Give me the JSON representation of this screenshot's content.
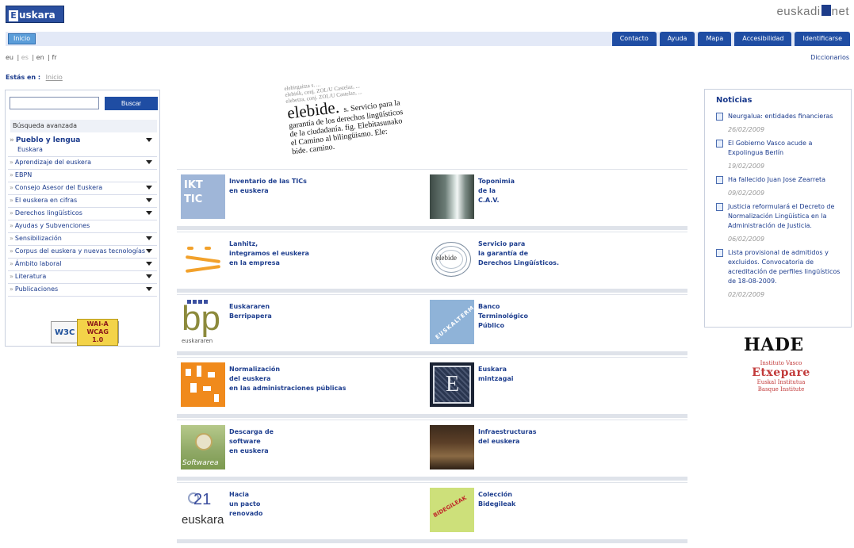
{
  "header": {
    "logo_text": "uskara",
    "logo_letter": "E",
    "portal_left": "euskadi",
    "portal_right": "net"
  },
  "nav": {
    "home": "Inicio",
    "links": [
      "Contacto",
      "Ayuda",
      "Mapa",
      "Accesibilidad",
      "Identificarse"
    ]
  },
  "langs": [
    "eu",
    "es",
    "en",
    "fr"
  ],
  "dictionary": "Diccionarios",
  "breadcrumb": {
    "label": "Estás en :",
    "home": "Inicio"
  },
  "sidebar": {
    "search_placeholder": "",
    "search_button": "Buscar",
    "advanced": "Búsqueda avanzada",
    "items": [
      {
        "label": "Pueblo y lengua",
        "sub": "Euskara",
        "expand": true,
        "big": true
      },
      {
        "label": "Aprendizaje del euskera",
        "expand": true
      },
      {
        "label": "EBPN",
        "expand": false
      },
      {
        "label": "Consejo Asesor del Euskera",
        "expand": true
      },
      {
        "label": "El euskera en cifras",
        "expand": true
      },
      {
        "label": "Derechos lingüísticos",
        "expand": true
      },
      {
        "label": "Ayudas y Subvenciones",
        "expand": false
      },
      {
        "label": "Sensibilización",
        "expand": true
      },
      {
        "label": "Corpus del euskera y nuevas tecnologías",
        "expand": true
      },
      {
        "label": "Ámbito laboral",
        "expand": true
      },
      {
        "label": "Literatura",
        "expand": true
      },
      {
        "label": "Publicaciones",
        "expand": true
      }
    ],
    "badge": {
      "w3c": "W3C",
      "wai1": "WAI-A",
      "wai2": "WCAG 1.0"
    }
  },
  "elebide": {
    "ghost1": "elebirgaitza  s.  ...",
    "ghost2": "elebitik, conj. ZOL/U Castelaz, ...",
    "ghost3": "elebetza, conj. ZOL/U Castelaz, ...",
    "word": "elebide.",
    "line1": "s. Servicio para la",
    "line2": "garantía de los derechos lingüísticos",
    "line3": "de la ciudadanía. fig. Elebitasunako",
    "line4": "el Camino al bilingüismo. Ele:",
    "line5": "bide. camino."
  },
  "tiles": [
    {
      "left": "Inventario de las TICs\nen euskera",
      "right": "Toponimia\nde la\nC.A.V."
    },
    {
      "left": "Lanhitz,\nintegramos el euskera\nen la empresa",
      "right": "Servicio para\nla garantía de\nDerechos Lingüísticos."
    },
    {
      "left": "Euskararen\nBerripapera",
      "right": "Banco\nTerminológico\nPúblico"
    },
    {
      "left": "Normalización\ndel euskera\nen las administraciones públicas",
      "right": "Euskara\nmintzagai"
    },
    {
      "left": "Descarga de\nsoftware\nen euskera",
      "right": "Infraestructuras\ndel euskera"
    },
    {
      "left": "Hacia\nun pacto\nrenovado",
      "right": "Colección\nBidegileak"
    }
  ],
  "thumb_text": {
    "ikt1": "IKT",
    "ikt2": "TIC",
    "elebide_word": "elebide",
    "bp_letters": "bp",
    "bp_label": "euskararen",
    "euskalterm": "EUSKALTERM",
    "mintza_letter": "E",
    "software": "Softwarea",
    "e21_num": "21",
    "e21_word": "euskara",
    "bide": "BIDEGILEAK"
  },
  "news": {
    "title": "Noticias",
    "items": [
      {
        "text": "Neurgalua: entidades financieras",
        "date": "26/02/2009"
      },
      {
        "text": "El Gobierno Vasco acude a Expolingua Berlín",
        "date": "19/02/2009"
      },
      {
        "text": "Ha fallecido Juan Jose Zearreta",
        "date": "09/02/2009"
      },
      {
        "text": "Justicia reformulará el Decreto de Normalización Lingüística en la Administración de Justicia.",
        "date": "06/02/2009"
      },
      {
        "text": "Lista provisional de admitidos y excluidos. Convocatoria de acreditación de perfiles lingüísticos de 18-08-2009.",
        "date": "02/02/2009"
      }
    ]
  },
  "hade": "HADE",
  "etxepare": {
    "a": "Instituto Vasco",
    "b": "Etxepare",
    "c1": "Euskal Institutua",
    "c2": "Basque Institute"
  }
}
